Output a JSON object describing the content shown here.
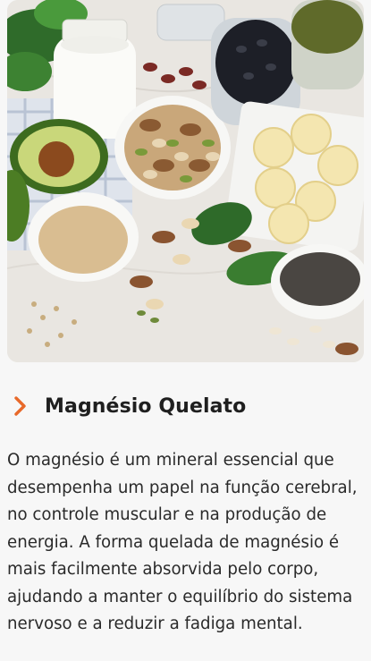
{
  "card": {
    "image_alt": "Alimentos ricos em magnésio",
    "title": "Magnésio Quelato",
    "description": "O magnésio é um mineral essencial que desempenha um papel na função cerebral, no controle muscular e na produção de energia. A forma quelada de magnésio é mais facilmente absorvida pelo corpo, ajudando a manter o equilíbrio do sistema nervoso e a reduzir a fadiga mental.",
    "chevron_icon": "chevron-right-icon",
    "accent_color": "#e8692a"
  }
}
